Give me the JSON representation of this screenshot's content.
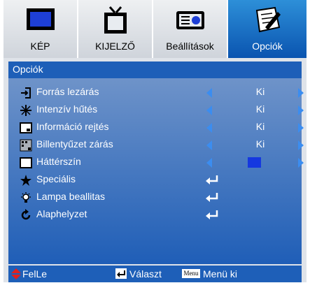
{
  "tabs": [
    {
      "label": "KÉP",
      "icon": "monitor-icon",
      "active": false
    },
    {
      "label": "KIJELZŐ",
      "icon": "tv-icon",
      "active": false
    },
    {
      "label": "Beállítások",
      "icon": "projector-icon",
      "active": false
    },
    {
      "label": "Opciók",
      "icon": "notepad-pencil-icon",
      "active": true
    }
  ],
  "section": {
    "title": "Opciók"
  },
  "rows": [
    {
      "label": "Forrás lezárás",
      "icon": "source-input-icon",
      "value": "Ki"
    },
    {
      "label": "Intenzív hűtés",
      "icon": "fan-icon",
      "value": "Ki"
    },
    {
      "label": " Információ rejtés",
      "icon": "info-screen-icon",
      "value": "Ki"
    },
    {
      "label": "Billentyűzet zárás",
      "icon": "keypad-icon",
      "value": "Ki"
    },
    {
      "label": "Háttérszín",
      "icon": "background-screen-icon",
      "value_color": "#1538e0"
    },
    {
      "label": "Speciális",
      "icon": "star-icon",
      "action": "enter"
    },
    {
      "label": "Lampa beallitas",
      "icon": "lamp-icon",
      "action": "enter"
    },
    {
      "label": "Alaphelyzet",
      "icon": "reset-icon",
      "action": "enter"
    }
  ],
  "footer": {
    "move": "FelLe",
    "select": "Választ",
    "menu_key": "Menu",
    "menu_exit": "Menü ki"
  },
  "colors": {
    "active_tab": "#0a54b0",
    "header": "#1e5fb8",
    "arrow": "#3b8df0",
    "bg_color_swatch": "#1538e0"
  }
}
